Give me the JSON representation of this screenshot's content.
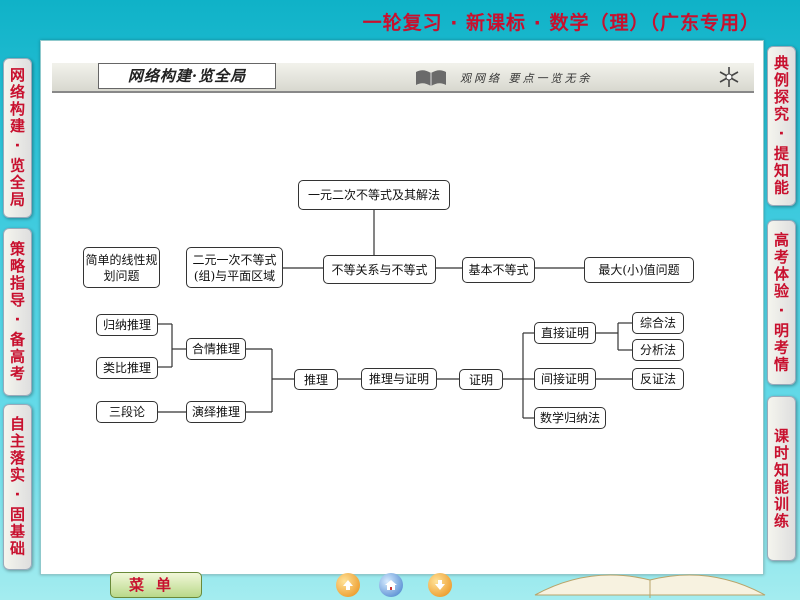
{
  "header": {
    "title": "一轮复习 · 新课标 · 数学（理）（广东专用）"
  },
  "left_tabs": [
    {
      "label": "网络构建 · 览全局"
    },
    {
      "label": "策略指导 · 备高考"
    },
    {
      "label": "自主落实 · 固基础"
    }
  ],
  "right_tabs": [
    {
      "label": "典例探究 · 提知能"
    },
    {
      "label": "高考体验 · 明考情"
    },
    {
      "label": "课时知能训练"
    }
  ],
  "section_bar": {
    "label": "网络构建·览全局",
    "motto": "观网络 要点一览无余"
  },
  "diagram1": {
    "quad": "一元二次不等式及其解法",
    "linear_prog": "简单的线性规划问题",
    "linear_ineq": "二元一次不等式(组)与平面区域",
    "center": "不等关系与不等式",
    "basic": "基本不等式",
    "maxmin": "最大(小)值问题"
  },
  "diagram2": {
    "induction": "归纳推理",
    "analogy": "类比推理",
    "syllogism": "三段论",
    "plausible": "合情推理",
    "deductive": "演绎推理",
    "reasoning": "推理",
    "center": "推理与证明",
    "proof": "证明",
    "direct": "直接证明",
    "indirect": "间接证明",
    "math_induction": "数学归纳法",
    "synthetic": "综合法",
    "analytic": "分析法",
    "contradiction": "反证法"
  },
  "bottom": {
    "menu_label": "菜单"
  }
}
